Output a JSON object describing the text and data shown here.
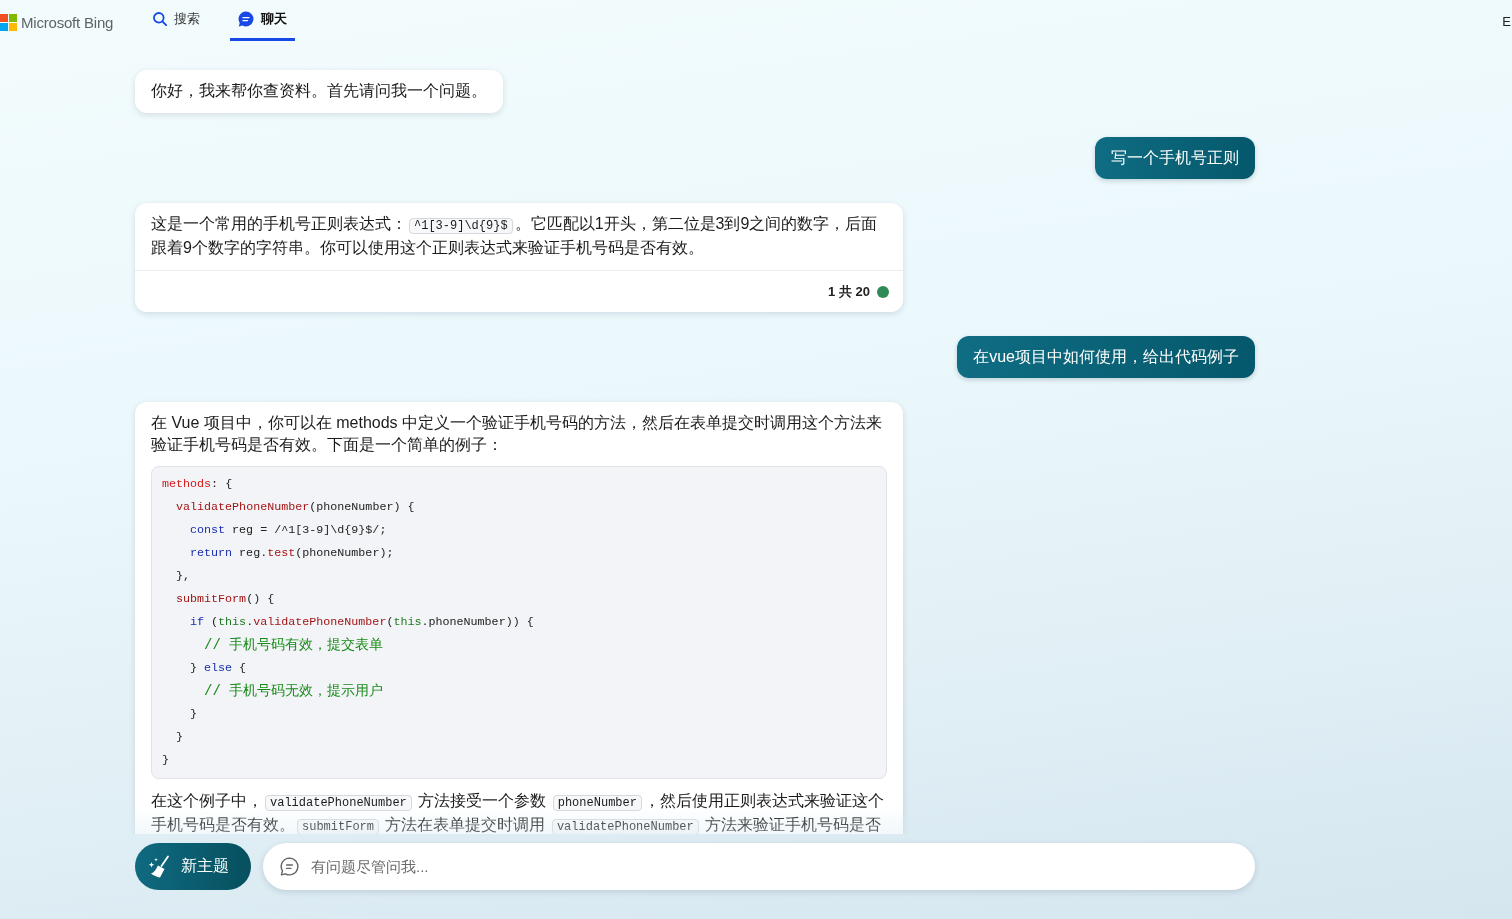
{
  "header": {
    "logo_text": "Microsoft Bing",
    "tabs": [
      {
        "kind": "search",
        "label": "搜索",
        "selected": false
      },
      {
        "kind": "chat",
        "label": "聊天",
        "selected": true
      }
    ],
    "corner_text": "E"
  },
  "messages": [
    {
      "kind": "bot",
      "blocks": [
        {
          "kind": "paragraph",
          "parts": [
            {
              "kind": "text",
              "text": "你好，我来帮你查资料。首先请问我一个问题。"
            }
          ]
        }
      ]
    },
    {
      "kind": "user",
      "text": "写一个手机号正则"
    },
    {
      "kind": "bot",
      "blocks": [
        {
          "kind": "paragraph",
          "parts": [
            {
              "kind": "text",
              "text": "这是一个常用的手机号正则表达式："
            },
            {
              "kind": "code",
              "text": "^1[3-9]\\d{9}$"
            },
            {
              "kind": "text",
              "text": "。它匹配以1开头，第二位是3到9之间的数字，后面跟着9个数字的字符串。你可以使用这个正则表达式来验证手机号码是否有效。"
            }
          ]
        }
      ],
      "footer": {
        "count": "1 共 20"
      }
    },
    {
      "kind": "user",
      "text": "在vue项目中如何使用，给出代码例子"
    },
    {
      "kind": "bot",
      "blocks": [
        {
          "kind": "paragraph",
          "parts": [
            {
              "kind": "text",
              "text": "在 Vue 项目中，你可以在 methods 中定义一个验证手机号码的方法，然后在表单提交时调用这个方法来验证手机号码是否有效。下面是一个简单的例子："
            }
          ]
        },
        {
          "kind": "code",
          "lines": [
            {
              "tokens": [
                {
                  "kind": "property",
                  "text": "methods"
                },
                {
                  "kind": "plain",
                  "text": ": {"
                }
              ],
              "children": [
                {
                  "tokens": [
                    {
                      "kind": "function",
                      "text": "validatePhoneNumber"
                    },
                    {
                      "kind": "plain",
                      "text": "(phoneNumber) {"
                    }
                  ],
                  "children": [
                    {
                      "tokens": [
                        {
                          "kind": "keyword",
                          "text": "const"
                        },
                        {
                          "kind": "plain",
                          "text": " reg = /^1[3-9]\\d{9}$/;"
                        }
                      ]
                    },
                    {
                      "tokens": [
                        {
                          "kind": "keyword",
                          "text": "return"
                        },
                        {
                          "kind": "plain",
                          "text": " reg."
                        },
                        {
                          "kind": "function",
                          "text": "test"
                        },
                        {
                          "kind": "plain",
                          "text": "(phoneNumber);"
                        }
                      ]
                    }
                  ]
                },
                {
                  "tokens": [
                    {
                      "kind": "plain",
                      "text": "},"
                    }
                  ]
                },
                {
                  "tokens": [
                    {
                      "kind": "function",
                      "text": "submitForm"
                    },
                    {
                      "kind": "plain",
                      "text": "() {"
                    }
                  ],
                  "children": [
                    {
                      "tokens": [
                        {
                          "kind": "keyword",
                          "text": "if"
                        },
                        {
                          "kind": "plain",
                          "text": " ("
                        },
                        {
                          "kind": "this",
                          "text": "this"
                        },
                        {
                          "kind": "plain",
                          "text": "."
                        },
                        {
                          "kind": "function",
                          "text": "validatePhoneNumber"
                        },
                        {
                          "kind": "plain",
                          "text": "("
                        },
                        {
                          "kind": "this",
                          "text": "this"
                        },
                        {
                          "kind": "plain",
                          "text": ".phoneNumber)) {"
                        }
                      ],
                      "children": [
                        {
                          "tokens": [
                            {
                              "kind": "comment",
                              "text": "// 手机号码有效，提交表单"
                            }
                          ]
                        }
                      ]
                    },
                    {
                      "tokens": [
                        {
                          "kind": "plain",
                          "text": "} "
                        },
                        {
                          "kind": "keyword",
                          "text": "else"
                        },
                        {
                          "kind": "plain",
                          "text": " {"
                        }
                      ],
                      "children": [
                        {
                          "tokens": [
                            {
                              "kind": "comment",
                              "text": "// 手机号码无效，提示用户"
                            }
                          ]
                        }
                      ]
                    },
                    {
                      "tokens": [
                        {
                          "kind": "plain",
                          "text": "}"
                        }
                      ]
                    }
                  ]
                },
                {
                  "tokens": [
                    {
                      "kind": "plain",
                      "text": "}"
                    }
                  ]
                }
              ]
            },
            {
              "tokens": [
                {
                  "kind": "plain",
                  "text": "}"
                }
              ]
            }
          ]
        },
        {
          "kind": "paragraph",
          "parts": [
            {
              "kind": "text",
              "text": "在这个例子中，"
            },
            {
              "kind": "code",
              "text": "validatePhoneNumber"
            },
            {
              "kind": "text",
              "text": " 方法接受一个参数 "
            },
            {
              "kind": "code",
              "text": "phoneNumber"
            },
            {
              "kind": "text",
              "text": "，然后使用正则表达式来验证这个手机号码是否有效。"
            },
            {
              "kind": "code",
              "text": "submitForm"
            },
            {
              "kind": "text",
              "text": " 方法在表单提交时调用 "
            },
            {
              "kind": "code",
              "text": "validatePhoneNumber"
            },
            {
              "kind": "text",
              "text": " 方法来验证手机号码是否"
            }
          ]
        }
      ]
    }
  ],
  "composer": {
    "new_topic_button": "新主题",
    "placeholder": "有问题尽管问我..."
  }
}
